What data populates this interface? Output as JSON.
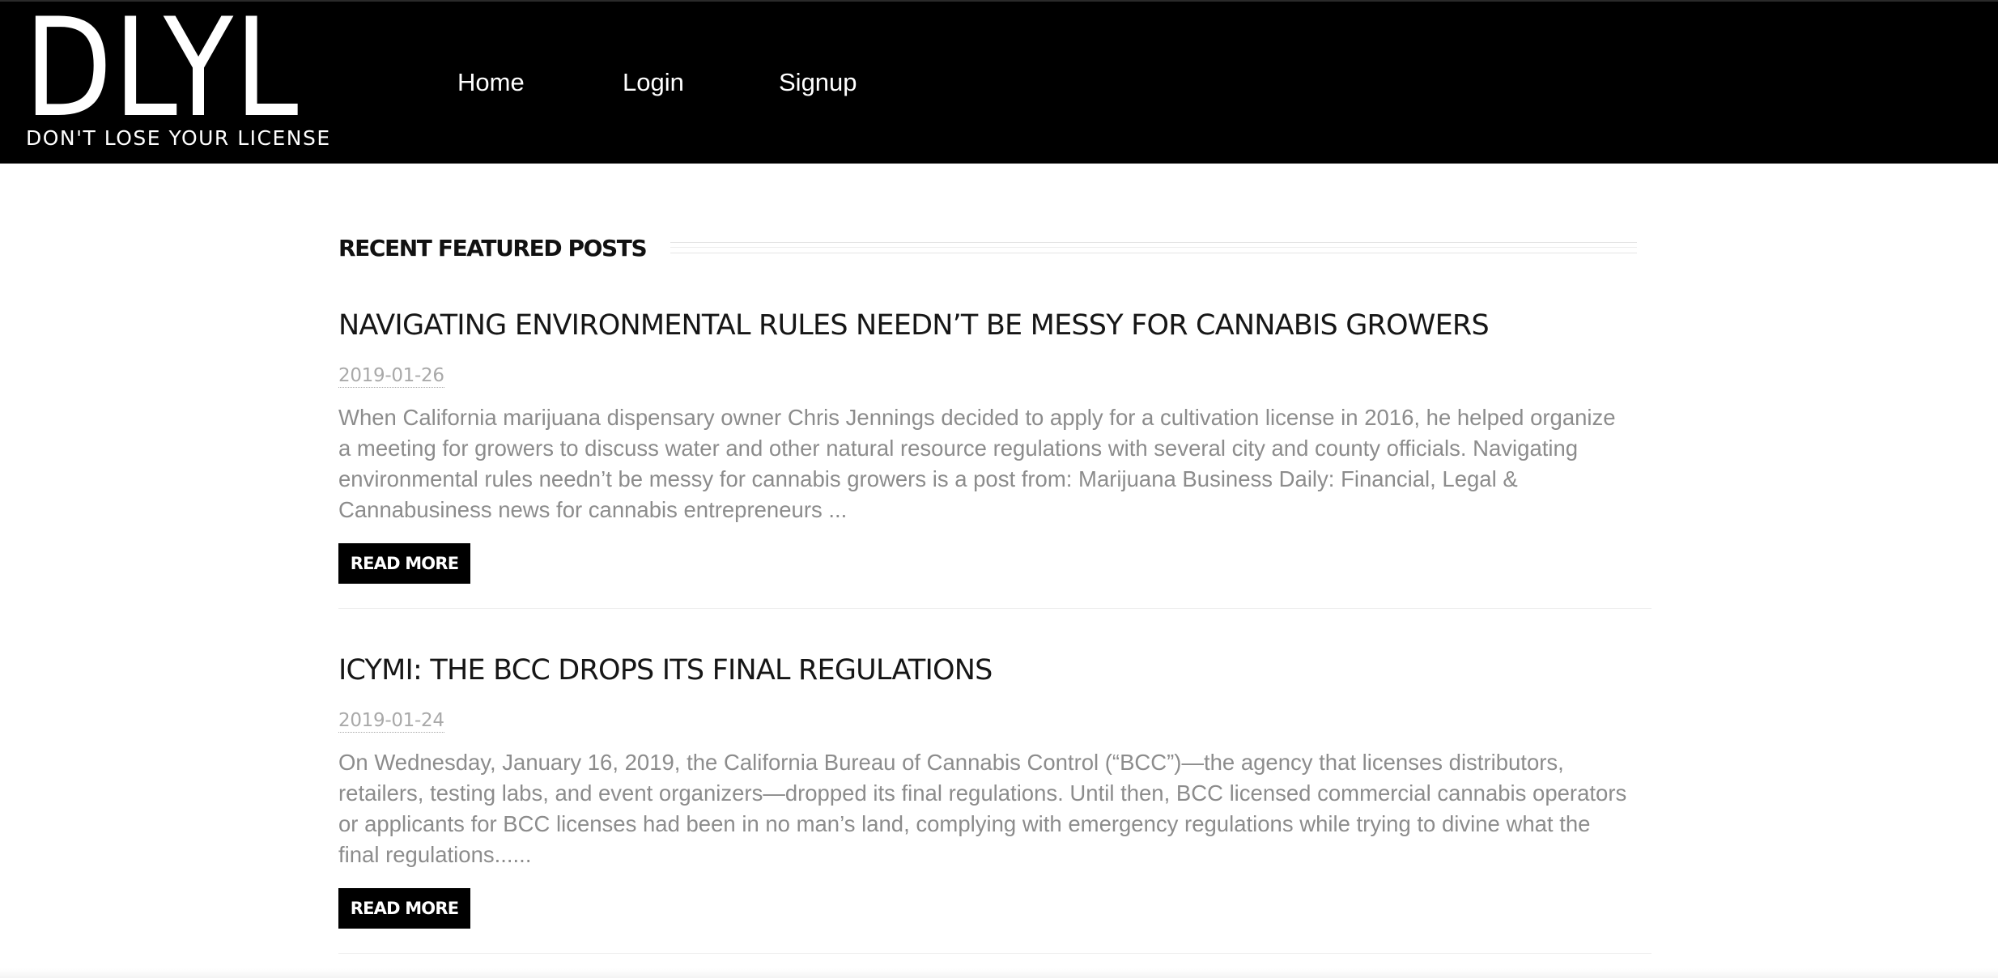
{
  "site": {
    "logo_main": "DLYL",
    "logo_tagline": "DON'T LOSE YOUR LICENSE"
  },
  "nav": {
    "items": [
      {
        "label": "Home"
      },
      {
        "label": "Login"
      },
      {
        "label": "Signup"
      }
    ]
  },
  "section": {
    "title": "RECENT FEATURED POSTS"
  },
  "posts": [
    {
      "title": "NAVIGATING ENVIRONMENTAL RULES NEEDN’T BE MESSY FOR CANNABIS GROWERS",
      "date": "2019-01-26",
      "excerpt": "When California marijuana dispensary owner Chris Jennings decided to apply for a cultivation license in 2016, he helped organize a meeting for growers to discuss water and other natural resource regulations with several city and county officials. Navigating environmental rules needn’t be messy for cannabis growers is a post from: Marijuana Business Daily: Financial, Legal & Cannabusiness news for cannabis entrepreneurs ...",
      "read_more": "READ MORE"
    },
    {
      "title": "ICYMI: THE BCC DROPS ITS FINAL REGULATIONS",
      "date": "2019-01-24",
      "excerpt": "On Wednesday, January 16, 2019, the California Bureau of Cannabis Control (“BCC”)—the agency that licenses distributors, retailers, testing labs, and event organizers—dropped its final regulations. Until then, BCC licensed commercial cannabis operators or applicants for BCC licenses had been in no man’s land, complying with emergency regulations while trying to divine what the final regulations......",
      "read_more": "READ MORE"
    }
  ],
  "colors": {
    "header_bg": "#000000",
    "header_text": "#ffffff",
    "title_text": "#161616",
    "excerpt_text": "#8c8c8c",
    "date_text": "#a9a9a9",
    "button_bg": "#000000"
  }
}
